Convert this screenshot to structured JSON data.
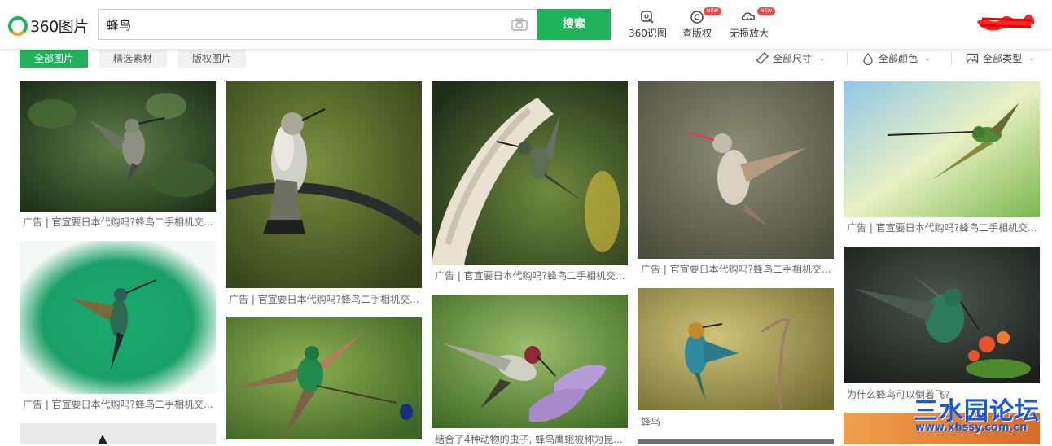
{
  "header": {
    "logo_text": "360图片",
    "search_value": "蜂鸟",
    "search_button": "搜索",
    "tools": [
      {
        "label": "360识图",
        "badge": ""
      },
      {
        "label": "查版权",
        "badge": "NEW"
      },
      {
        "label": "无损放大",
        "badge": "NEW"
      }
    ]
  },
  "tabs": [
    {
      "label": "全部图片",
      "active": true
    },
    {
      "label": "精选素材",
      "active": false
    },
    {
      "label": "版权图片",
      "active": false
    }
  ],
  "filters": [
    {
      "label": "全部尺寸",
      "icon": "ruler-icon"
    },
    {
      "label": "全部颜色",
      "icon": "color-drop-icon"
    },
    {
      "label": "全部类型",
      "icon": "image-type-icon"
    }
  ],
  "results": {
    "col1": [
      {
        "caption": "广告 | 官宣要日本代购吗?蜂鸟二手相机交..."
      },
      {
        "caption": "广告 | 官宣要日本代购吗?蜂鸟二手相机交..."
      }
    ],
    "col2": [
      {
        "caption": "广告 | 官宣要日本代购吗?蜂鸟二手相机交..."
      }
    ],
    "col3": [
      {
        "caption": "广告 | 官宣要日本代购吗?蜂鸟二手相机交..."
      },
      {
        "caption": "结合了4种动物的虫子, 蜂鸟鹰蛾被称为昆..."
      }
    ],
    "col4": [
      {
        "caption": "广告 | 官宣要日本代购吗?蜂鸟二手相机交..."
      },
      {
        "caption": "蜂鸟"
      }
    ],
    "col5": [
      {
        "caption": "广告 | 官宣要日本代购吗?蜂鸟二手相机交..."
      },
      {
        "caption": "为什么蜂鸟可以倒着飞?"
      }
    ]
  },
  "watermark": {
    "text": "三水园论坛",
    "url": "www.xhssy.com.cn"
  },
  "colors": {
    "accent": "#1fb35a",
    "badge": "#f04a4a",
    "watermark": "#1a57d9"
  }
}
